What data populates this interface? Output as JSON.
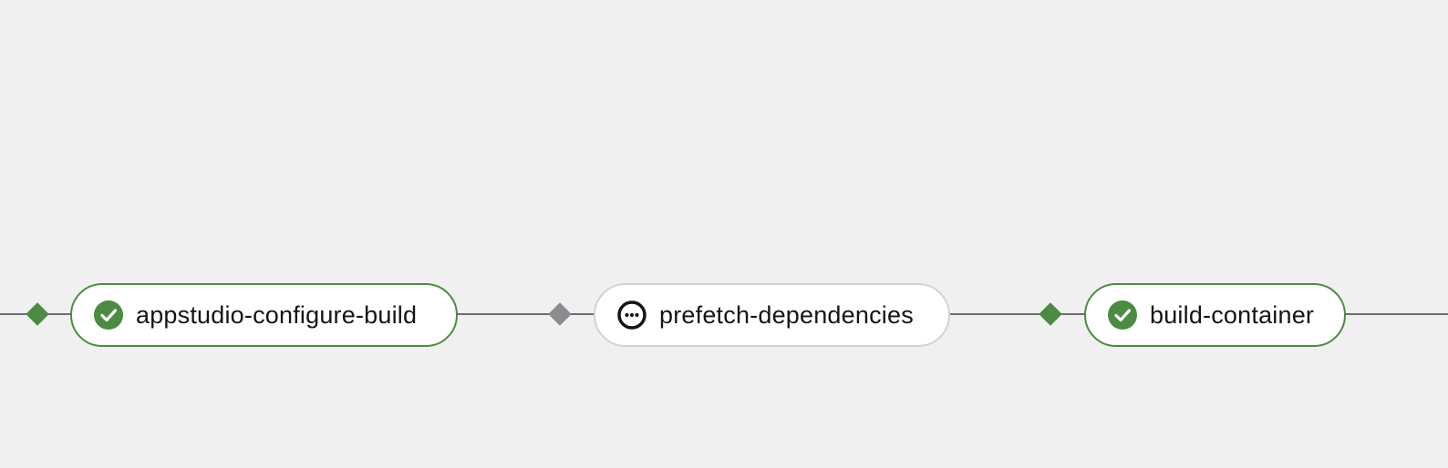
{
  "pipeline": {
    "tasks": [
      {
        "name": "appstudio-configure-build",
        "status": "success",
        "icon": "check-circle-icon",
        "color": "#4d8a42"
      },
      {
        "name": "prefetch-dependencies",
        "status": "pending",
        "icon": "ellipsis-circle-icon",
        "color": "#151515"
      },
      {
        "name": "build-container",
        "status": "success",
        "icon": "check-circle-icon",
        "color": "#4d8a42"
      }
    ]
  },
  "colors": {
    "background": "#f0f0f0",
    "edge": "#6a6e73",
    "success": "#4d8a42",
    "pending": "#8a8d90",
    "pending_border": "#d2d2d2"
  }
}
